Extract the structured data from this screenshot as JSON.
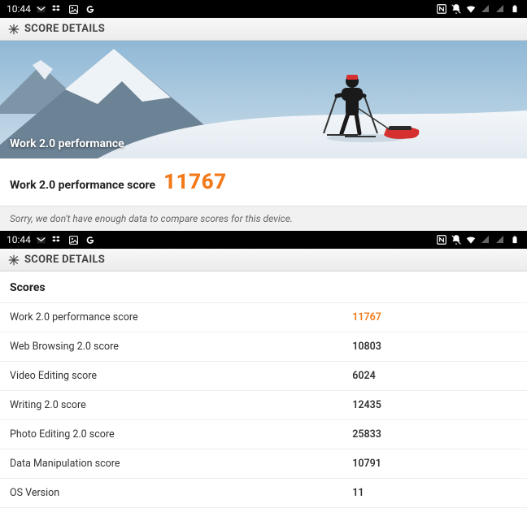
{
  "statusbar": {
    "time": "10:44"
  },
  "header": {
    "title": "SCORE DETAILS"
  },
  "hero": {
    "label": "Work 2.0 performance"
  },
  "primary": {
    "label": "Work 2.0 performance score",
    "value": "11767",
    "note": "Sorry, we don't have enough data to compare scores for this device."
  },
  "scores_section": {
    "statusbar": {
      "time": "10:44"
    },
    "header": {
      "title": "SCORE DETAILS"
    },
    "heading": "Scores",
    "rows": [
      {
        "label": "Work 2.0 performance score",
        "value": "11767",
        "primary": true
      },
      {
        "label": "Web Browsing 2.0 score",
        "value": "10803"
      },
      {
        "label": "Video Editing score",
        "value": "6024"
      },
      {
        "label": "Writing 2.0 score",
        "value": "12435"
      },
      {
        "label": "Photo Editing 2.0 score",
        "value": "25833"
      },
      {
        "label": "Data Manipulation score",
        "value": "10791"
      },
      {
        "label": "OS Version",
        "value": "11"
      }
    ]
  }
}
